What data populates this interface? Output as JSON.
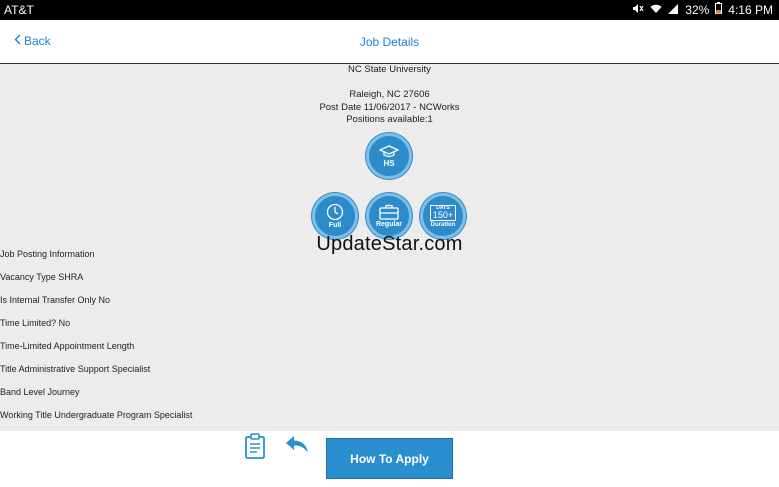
{
  "status": {
    "carrier": "AT&T",
    "battery": "32%",
    "time": "4:16 PM"
  },
  "header": {
    "back_label": "Back",
    "title": "Job Details"
  },
  "job": {
    "employer": "NC State University",
    "location": "Raleigh, NC 27606",
    "post_date": "Post Date 11/06/2017 - NCWorks",
    "positions": "Positions available:1"
  },
  "badges": {
    "education": "HS",
    "schedule": "Full",
    "type": "Regular",
    "duration_top": "DAYS",
    "duration_value": "150+",
    "duration_label": "Duration"
  },
  "watermark": "UpdateStar.com",
  "details": [
    "Job Posting Information",
    "Vacancy Type SHRA",
    "Is Internal Transfer Only No",
    "Time Limited? No",
    "Time-Limited Appointment Length",
    "Title Administrative Support Specialist",
    "Band Level Journey",
    "Working Title Undergraduate Program Specialist"
  ],
  "footer": {
    "apply_label": "How To Apply"
  },
  "colors": {
    "accent": "#1b86c8",
    "button": "#2a8fcf",
    "background": "#ececec"
  }
}
